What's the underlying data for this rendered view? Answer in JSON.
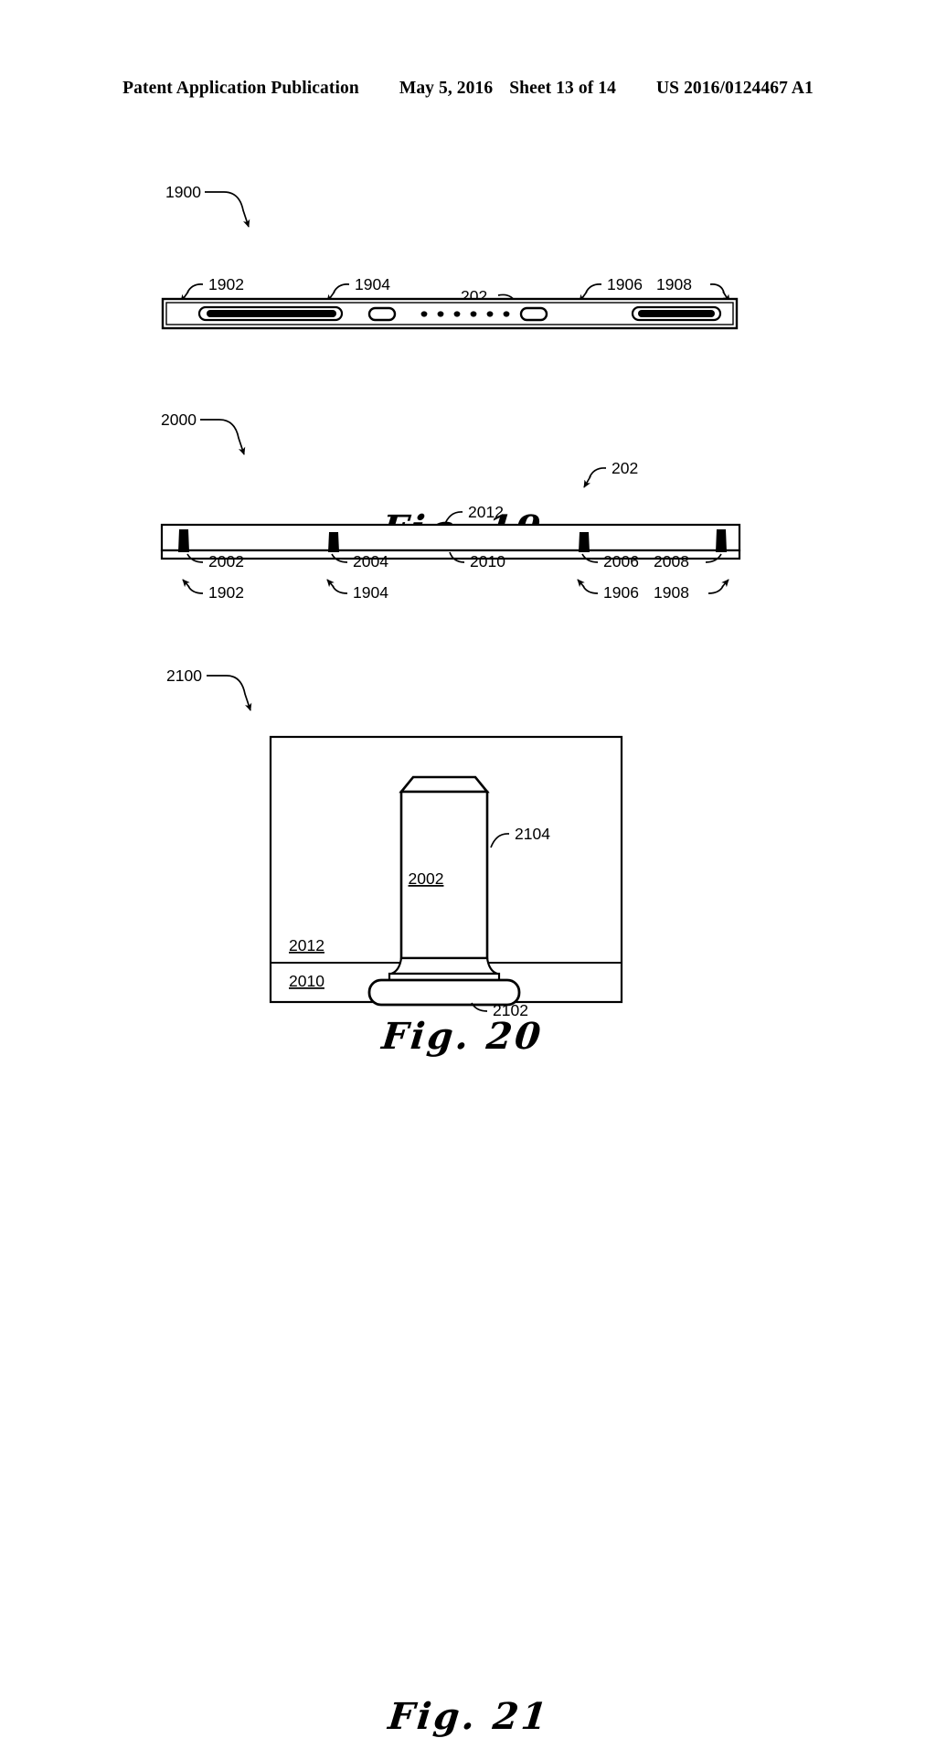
{
  "document": {
    "type": "patent-drawing-sheet",
    "header": {
      "publication": "Patent Application Publication",
      "date": "May 5, 2016",
      "sheet": "Sheet 13 of 14",
      "publication_number": "US 2016/0124467 A1"
    },
    "ink_color": "#000000",
    "paper_color": "#ffffff"
  },
  "figures": [
    {
      "id": "figure-19",
      "caption": "Fig. 19",
      "assembly_number": "1900",
      "description": "Edge elevation view of a device bar with two long slots, two short slots, and a row of six round apertures.",
      "aperture_count": 6,
      "labels": [
        {
          "text": "1900",
          "kind": "assembly-leader"
        },
        {
          "text": "1902",
          "kind": "callout-arrow"
        },
        {
          "text": "1904",
          "kind": "callout-arrow"
        },
        {
          "text": "202",
          "kind": "callout-leader"
        },
        {
          "text": "1906",
          "kind": "callout-arrow"
        },
        {
          "text": "1908",
          "kind": "callout-arrow"
        }
      ]
    },
    {
      "id": "figure-20",
      "caption": "Fig. 20",
      "assembly_number": "2000",
      "description": "Cross-sectional side view of the panel showing four upright posts mounted through a thin substrate layer.",
      "post_count": 4,
      "labels": [
        {
          "text": "2000",
          "kind": "assembly-leader"
        },
        {
          "text": "202",
          "kind": "callout-arrow"
        },
        {
          "text": "2012",
          "kind": "callout-leader"
        },
        {
          "text": "2002",
          "kind": "callout-leader"
        },
        {
          "text": "2004",
          "kind": "callout-leader"
        },
        {
          "text": "2010",
          "kind": "callout-leader"
        },
        {
          "text": "2006",
          "kind": "callout-leader"
        },
        {
          "text": "2008",
          "kind": "callout-leader"
        },
        {
          "text": "1902",
          "kind": "callout-arrow"
        },
        {
          "text": "1904",
          "kind": "callout-arrow"
        },
        {
          "text": "1906",
          "kind": "callout-arrow"
        },
        {
          "text": "1908",
          "kind": "callout-arrow"
        }
      ]
    },
    {
      "id": "figure-21",
      "caption": "Fig. 21",
      "assembly_number": "2100",
      "description": "Enlarged detail cross-section of a single post seated in the layered substrate, showing the chamfered crown, the shank and the rounded foot.",
      "labels": [
        {
          "text": "2100",
          "kind": "assembly-leader"
        },
        {
          "text": "2104",
          "kind": "callout-leader"
        },
        {
          "text": "2002",
          "kind": "inline-underlined"
        },
        {
          "text": "2012",
          "kind": "inline-underlined"
        },
        {
          "text": "2010",
          "kind": "inline-underlined"
        },
        {
          "text": "2102",
          "kind": "callout-leader"
        }
      ]
    }
  ]
}
